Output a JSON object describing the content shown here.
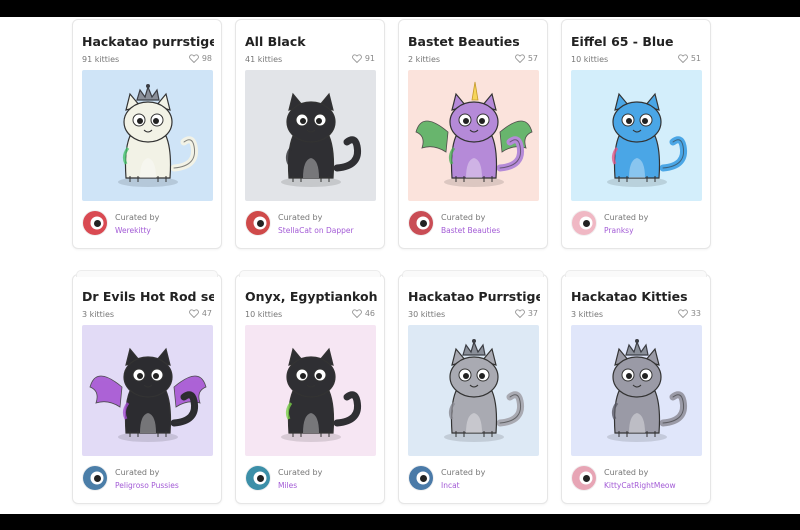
{
  "labels": {
    "curated_by": "Curated by"
  },
  "colors": {
    "curator_link": "#a35bd6",
    "title": "#222222",
    "meta": "#777777"
  },
  "cards": [
    {
      "title": "Hackatao purrstiges",
      "count": "91 kitties",
      "likes": "98",
      "curator": "Werekitty",
      "art_bg": "#cfe4f7",
      "cat_color": "#f2f2e6",
      "accent": "#47c26b",
      "avatar": "#d94a52",
      "crown": true,
      "wings": false,
      "horn": false
    },
    {
      "title": "All Black",
      "count": "41 kitties",
      "likes": "91",
      "curator": "StellaCat on Dapper",
      "art_bg": "#e2e4e8",
      "cat_color": "#2f2f33",
      "accent": "#2f2f33",
      "avatar": "#cf4a4a",
      "crown": false,
      "wings": false,
      "horn": false
    },
    {
      "title": "Bastet Beauties",
      "count": "2 kitties",
      "likes": "57",
      "curator": "Bastet Beauties",
      "art_bg": "#fbe3dc",
      "cat_color": "#b58ad8",
      "accent": "#4fae5a",
      "avatar": "#c94d55",
      "crown": false,
      "wings": true,
      "horn": true
    },
    {
      "title": "Eiffel 65 - Blue",
      "count": "10 kitties",
      "likes": "51",
      "curator": "Pranksy",
      "art_bg": "#d3eefb",
      "cat_color": "#4aa6e6",
      "accent": "#e25a8a",
      "avatar": "#f0b8c4",
      "crown": false,
      "wings": false,
      "horn": false
    },
    {
      "title": "Dr Evils Hot Rod seri…",
      "count": "3 kitties",
      "likes": "47",
      "curator": "Peligroso Pussies",
      "art_bg": "#e2dbf6",
      "cat_color": "#2c2c30",
      "accent": "#a34ed1",
      "avatar": "#4b7ea8",
      "crown": false,
      "wings": true,
      "horn": false
    },
    {
      "title": "Onyx, Egyptiankohl, …",
      "count": "10 kitties",
      "likes": "46",
      "curator": "Miles",
      "art_bg": "#f6e6f3",
      "cat_color": "#2f2f33",
      "accent": "#7bd14a",
      "avatar": "#3c8fa8",
      "crown": false,
      "wings": false,
      "horn": false
    },
    {
      "title": "Hackatao Purrstige",
      "count": "30 kitties",
      "likes": "37",
      "curator": "Incat",
      "art_bg": "#dde9f5",
      "cat_color": "#a9aab2",
      "accent": "#8a8a92",
      "avatar": "#4a7aa8",
      "crown": true,
      "wings": false,
      "horn": false
    },
    {
      "title": "Hackatao Kitties",
      "count": "3 kitties",
      "likes": "33",
      "curator": "KittyCatRightMeow",
      "art_bg": "#e0e6fa",
      "cat_color": "#9a9aa6",
      "accent": "#5a5a66",
      "avatar": "#e7a5b5",
      "crown": true,
      "wings": false,
      "horn": false
    }
  ]
}
